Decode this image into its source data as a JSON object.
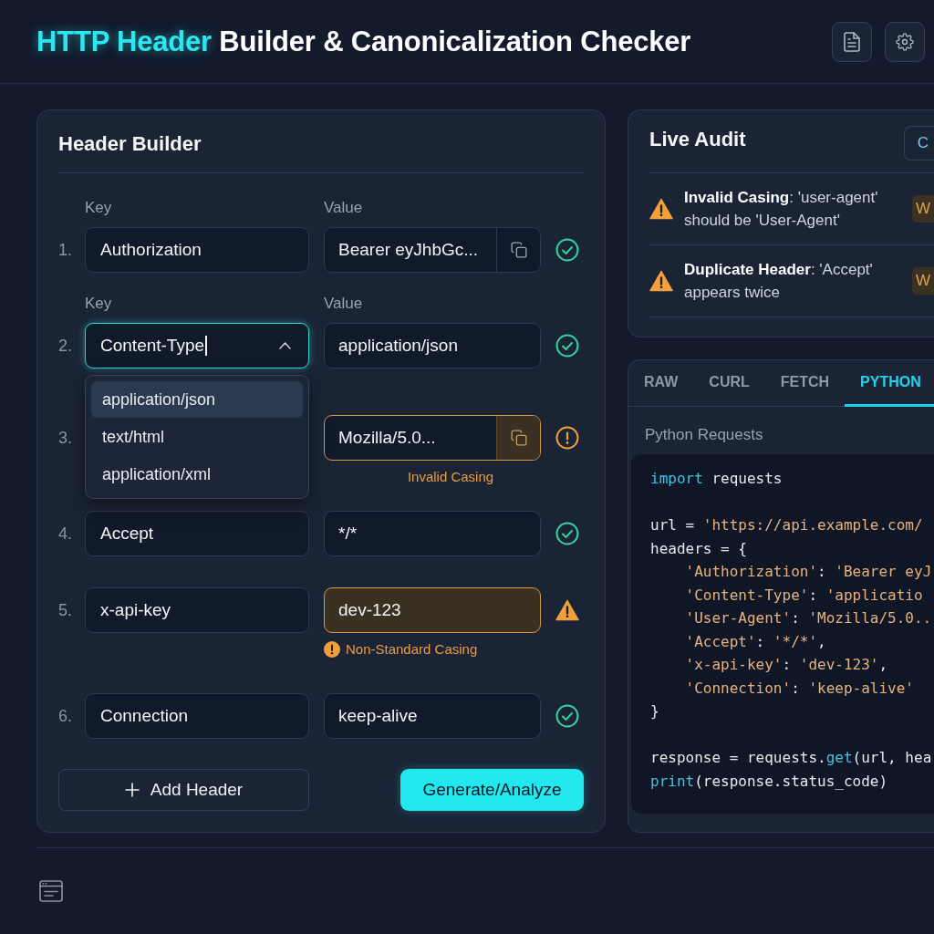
{
  "header": {
    "title_accent": "HTTP Header",
    "title_rest": "Builder & Canonicalization Checker"
  },
  "builder": {
    "title": "Header Builder",
    "rows": [
      {
        "number": "1.",
        "labels": {
          "key": "Key",
          "value": "Value"
        },
        "key": "Authorization",
        "focused": false,
        "value": "Bearer eyJhbGc...",
        "copy": true,
        "kind": "ok"
      },
      {
        "number": "2.",
        "labels": {
          "key": "Key",
          "value": "Value"
        },
        "key": "Content-Type",
        "focused": true,
        "expanded": true,
        "options": [
          {
            "label": "application/json",
            "selected": true
          },
          {
            "label": "text/html",
            "selected": false
          },
          {
            "label": "application/xml",
            "selected": false
          }
        ],
        "value": "application/json",
        "copy": false,
        "kind": "ok"
      },
      {
        "number": "3.",
        "value": "Mozilla/5.0...",
        "copy": true,
        "kind": "invalid",
        "message": {
          "text": "Invalid Casing",
          "icon": false
        }
      },
      {
        "number": "4.",
        "key": "Accept",
        "focused": false,
        "value": "*/*",
        "copy": false,
        "kind": "ok"
      },
      {
        "number": "5.",
        "key": "x-api-key",
        "focused": false,
        "value": "dev-123",
        "copy": false,
        "kind": "warning",
        "message": {
          "text": "Non-Standard Casing",
          "icon": true
        }
      },
      {
        "number": "6.",
        "key": "Connection",
        "focused": false,
        "value": "keep-alive",
        "copy": false,
        "kind": "ok"
      }
    ],
    "add_button": "Add Header",
    "submit_button": "Generate/Analyze"
  },
  "audit": {
    "title": "Live Audit",
    "button": "C",
    "items": [
      {
        "kind": "warning",
        "text": "**Invalid Casing**: 'user-agent' should be 'User-Agent'",
        "badge": "W"
      },
      {
        "kind": "warning",
        "text": "**Duplicate Header**: 'Accept' appears twice",
        "badge": "W"
      }
    ]
  },
  "output": {
    "tabs": [
      {
        "label": "RAW",
        "selected": false
      },
      {
        "label": "CURL",
        "selected": false
      },
      {
        "label": "FETCH",
        "selected": false
      },
      {
        "label": "PYTHON",
        "selected": true
      }
    ],
    "subtitle": "Python Requests",
    "code_blocks": [
      {
        "lines": [
          {
            "tokens": [
              {
                "kind": "keyword",
                "text": "import"
              },
              {
                "kind": "plain",
                "text": " requests"
              }
            ]
          }
        ]
      },
      {
        "lines": [
          {
            "tokens": [
              {
                "kind": "plain",
                "text": "url = "
              },
              {
                "kind": "string",
                "text": "'https://api.example.com/"
              }
            ]
          },
          {
            "tokens": [
              {
                "kind": "plain",
                "text": "headers = {"
              }
            ]
          },
          {
            "tokens": [
              {
                "kind": "string",
                "text": "    'Authorization'"
              },
              {
                "kind": "plain",
                "text": ": "
              },
              {
                "kind": "string",
                "text": "'Bearer eyJ"
              }
            ]
          },
          {
            "tokens": [
              {
                "kind": "string",
                "text": "    'Content-Type'"
              },
              {
                "kind": "plain",
                "text": ": "
              },
              {
                "kind": "string",
                "text": "'applicatio"
              }
            ]
          },
          {
            "tokens": [
              {
                "kind": "string",
                "text": "    'User-Agent'"
              },
              {
                "kind": "plain",
                "text": ": "
              },
              {
                "kind": "string",
                "text": "'Mozilla/5.0.."
              }
            ]
          },
          {
            "tokens": [
              {
                "kind": "string",
                "text": "    'Accept'"
              },
              {
                "kind": "plain",
                "text": ": "
              },
              {
                "kind": "string",
                "text": "'*/*'"
              },
              {
                "kind": "plain",
                "text": ","
              }
            ]
          },
          {
            "tokens": [
              {
                "kind": "string",
                "text": "    'x-api-key'"
              },
              {
                "kind": "plain",
                "text": ": "
              },
              {
                "kind": "string",
                "text": "'dev-123'"
              },
              {
                "kind": "plain",
                "text": ","
              }
            ]
          },
          {
            "tokens": [
              {
                "kind": "string",
                "text": "    'Connection'"
              },
              {
                "kind": "plain",
                "text": ": "
              },
              {
                "kind": "string",
                "text": "'keep-alive'"
              }
            ]
          },
          {
            "tokens": [
              {
                "kind": "plain",
                "text": "}"
              }
            ]
          }
        ]
      },
      {
        "lines": [
          {
            "tokens": [
              {
                "kind": "plain",
                "text": "response = requests."
              },
              {
                "kind": "keyword",
                "text": "get"
              },
              {
                "kind": "plain",
                "text": "(url, hea"
              }
            ]
          },
          {
            "tokens": [
              {
                "kind": "keyword",
                "text": "print"
              },
              {
                "kind": "plain",
                "text": "(response.status_code)"
              }
            ]
          }
        ]
      }
    ]
  }
}
